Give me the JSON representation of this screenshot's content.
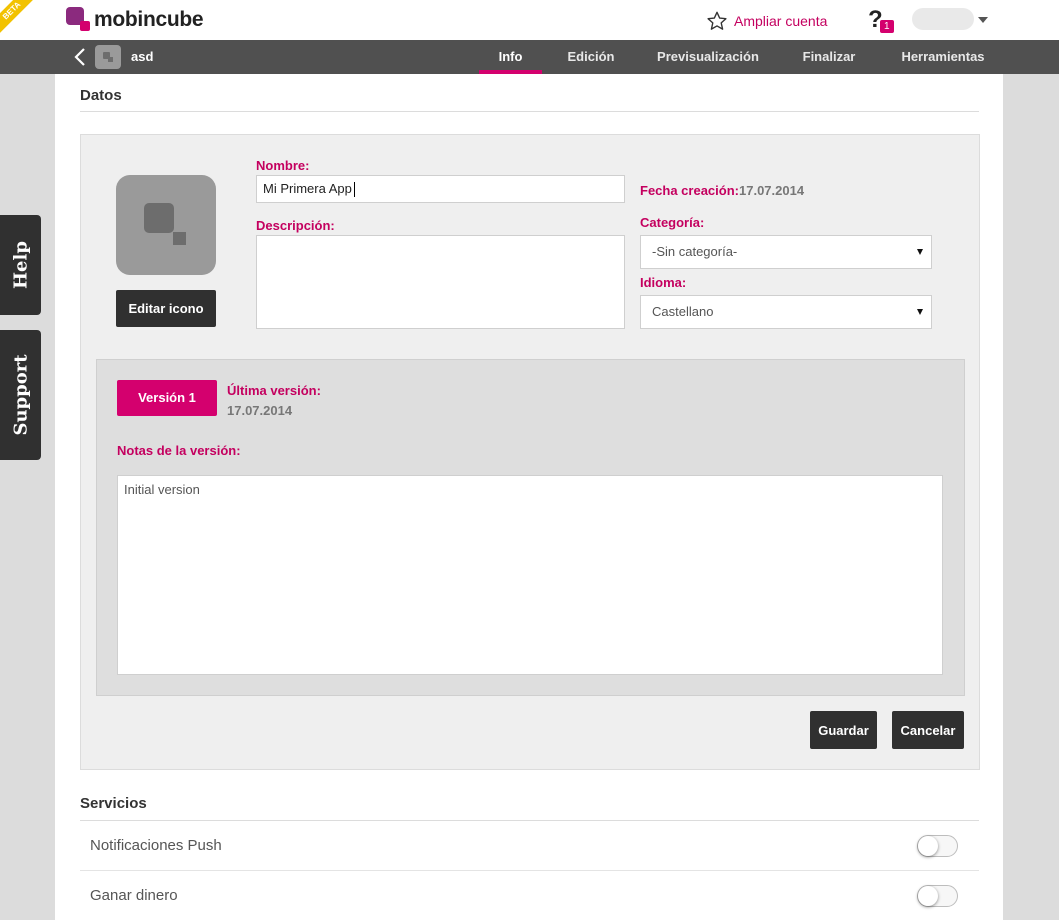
{
  "topbar": {
    "beta": "BETA",
    "logo_text": "mobincube",
    "upgrade_label": "Ampliar cuenta",
    "help_symbol": "?",
    "notification_count": "1"
  },
  "navbar": {
    "app_name": "asd",
    "tabs": [
      {
        "label": "Info",
        "active": true
      },
      {
        "label": "Edición",
        "active": false
      },
      {
        "label": "Previsualización",
        "active": false
      },
      {
        "label": "Finalizar",
        "active": false
      },
      {
        "label": "Herramientas",
        "active": false
      }
    ]
  },
  "side_tabs": {
    "help": "Help",
    "support": "Support"
  },
  "datos": {
    "title": "Datos",
    "edit_icon_label": "Editar icono",
    "name_label": "Nombre:",
    "name_value": "Mi Primera App",
    "description_label": "Descripción:",
    "description_value": "",
    "creation_label": "Fecha creación:",
    "creation_date": "17.07.2014",
    "category_label": "Categoría:",
    "category_value": "-Sin categoría-",
    "language_label": "Idioma:",
    "language_value": "Castellano"
  },
  "version": {
    "version_button": "Versión 1",
    "last_version_label": "Última versión:",
    "last_version_date": "17.07.2014",
    "notes_label": "Notas de la versión:",
    "notes_value": "Initial version"
  },
  "actions": {
    "save": "Guardar",
    "cancel": "Cancelar"
  },
  "servicios": {
    "title": "Servicios",
    "items": [
      {
        "label": "Notificaciones Push",
        "enabled": false
      },
      {
        "label": "Ganar dinero",
        "enabled": false
      }
    ]
  },
  "colors": {
    "accent": "#d4006e",
    "dark": "#303030",
    "navbar": "#505050"
  }
}
